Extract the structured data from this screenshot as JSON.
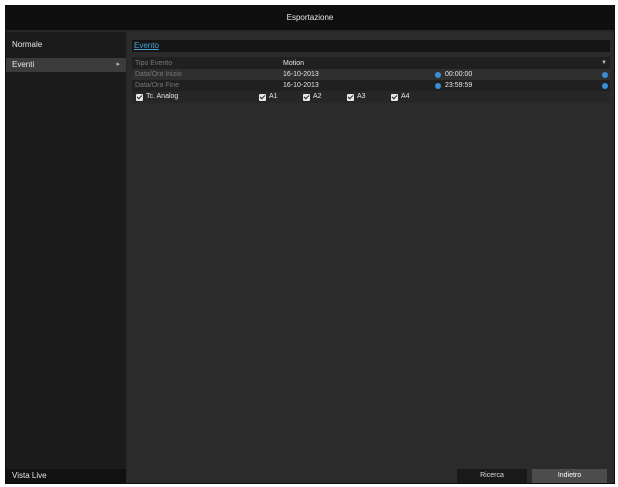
{
  "window": {
    "title": "Esportazione"
  },
  "sidebar": {
    "items": [
      {
        "label": "Normale",
        "active": false
      },
      {
        "label": "Eventi",
        "active": true
      }
    ],
    "bottom_label": "Vista Live"
  },
  "main": {
    "tab_label": "Evento",
    "form": {
      "event_type_label": "Tipo Evento",
      "event_type_value": "Motion",
      "start_label": "Data/Ora Inizio",
      "start_date": "16-10-2013",
      "start_time": "00:00:00",
      "end_label": "Data/Ora Fine",
      "end_date": "16-10-2013",
      "end_time": "23:59:59"
    },
    "channels": {
      "group_label": "Tc. Analog",
      "items": [
        "A1",
        "A2",
        "A3",
        "A4"
      ]
    }
  },
  "buttons": {
    "search_label": "Ricerca",
    "back_label": "Indietro"
  },
  "colors": {
    "accent": "#3a8ed6",
    "tab_link": "#4aa3d8"
  }
}
